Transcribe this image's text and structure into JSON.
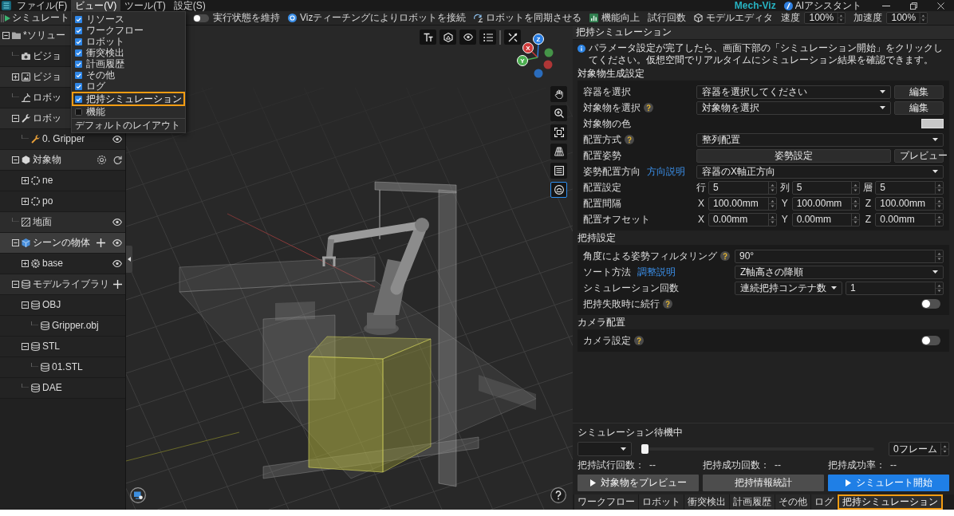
{
  "title_bar": {
    "menus": [
      {
        "label": "ファイル(F)",
        "selected": false
      },
      {
        "label": "ビュー(V)",
        "selected": true
      },
      {
        "label": "ツール(T)",
        "selected": false
      },
      {
        "label": "設定(S)",
        "selected": false
      }
    ],
    "app_name": "Mech-Viz",
    "assistant": "AIアシスタント"
  },
  "view_menu": [
    {
      "kind": "check",
      "label": "リソース",
      "checked": true,
      "highlighted": false
    },
    {
      "kind": "check",
      "label": "ワークフロー",
      "checked": true,
      "highlighted": false
    },
    {
      "kind": "check",
      "label": "ロボット",
      "checked": true,
      "highlighted": false
    },
    {
      "kind": "check",
      "label": "衝突検出",
      "checked": true,
      "highlighted": false
    },
    {
      "kind": "check",
      "label": "計画履歴",
      "checked": true,
      "highlighted": false
    },
    {
      "kind": "check",
      "label": "その他",
      "checked": true,
      "highlighted": false
    },
    {
      "kind": "check",
      "label": "ログ",
      "checked": true,
      "highlighted": false
    },
    {
      "kind": "check",
      "label": "把持シミュレーション",
      "checked": true,
      "highlighted": true
    },
    {
      "kind": "check",
      "label": "機能",
      "checked": false,
      "highlighted": false
    },
    {
      "kind": "action",
      "label": "デフォルトのレイアウト",
      "highlighted": false
    }
  ],
  "toolbar": {
    "keep_state": {
      "label": "実行状態を維持",
      "on": false
    },
    "actions": [
      {
        "label": "Vizティーチングによりロボットを接続"
      },
      {
        "label": "ロボットを同期させる"
      },
      {
        "label": "機能向上"
      },
      {
        "label": "試行回数"
      },
      {
        "label": "モデルエディタ"
      }
    ],
    "speed": {
      "label": "速度",
      "value": "100%"
    },
    "acceleration": {
      "label": "加速度",
      "value": "100%"
    }
  },
  "sidebar": {
    "simulate_button": "シミュレート",
    "tree": [
      {
        "kind": "solution",
        "label": "*ソリュー",
        "expanded": true,
        "selected": false,
        "children": [
          {
            "kind": "vision",
            "label": "ビジョ",
            "selected": false
          },
          {
            "kind": "visionset",
            "label": "ビジョ",
            "expanded": false,
            "selected": false
          },
          {
            "kind": "robot",
            "label": "ロボッ",
            "selected": false
          },
          {
            "kind": "tools",
            "label": "ロボッ",
            "expanded": true,
            "selected": false,
            "children": [
              {
                "kind": "tool",
                "label": "0. Gripper",
                "selected": false
              }
            ]
          },
          {
            "kind": "objects",
            "label": "対象物",
            "expanded": true,
            "selected": false,
            "children": [
              {
                "kind": "object",
                "label": "ne",
                "expanded": false,
                "selected": false
              },
              {
                "kind": "object",
                "label": "po",
                "expanded": false,
                "selected": false
              }
            ]
          },
          {
            "kind": "ground",
            "label": "地面",
            "selected": false
          },
          {
            "kind": "scene",
            "label": "シーンの物体",
            "expanded": true,
            "selected": true,
            "children": [
              {
                "kind": "sceneobject",
                "label": "base",
                "expanded": false,
                "selected": false
              }
            ]
          },
          {
            "kind": "library",
            "label": "モデルライブラリ",
            "expanded": true,
            "selected": false,
            "children": [
              {
                "kind": "folder",
                "label": "OBJ",
                "expanded": true,
                "selected": false,
                "children": [
                  {
                    "kind": "model",
                    "label": "Gripper.obj",
                    "selected": false
                  }
                ]
              },
              {
                "kind": "folder",
                "label": "STL",
                "expanded": true,
                "selected": false,
                "children": [
                  {
                    "kind": "model",
                    "label": "01.STL",
                    "selected": false
                  }
                ]
              },
              {
                "kind": "folder",
                "label": "DAE",
                "selected": false
              }
            ]
          }
        ]
      }
    ]
  },
  "viewport": {
    "axes": [
      {
        "label": "Z"
      },
      {
        "label": "X"
      },
      {
        "label": "Y"
      }
    ],
    "side_tools": [
      {
        "selected": false
      },
      {
        "selected": false
      },
      {
        "selected": false
      },
      {
        "selected": false
      },
      {
        "selected": false
      },
      {
        "selected": true
      }
    ]
  },
  "panel": {
    "title": "把持シミュレーション",
    "info": "パラメータ設定が完了したら、画面下部の「シミュレーション開始」をクリックしてください。仮想空間でリアルタイムにシミュレーション結果を確認できます。",
    "sections": [
      {
        "title": "対象物生成設定",
        "rows": [
          {
            "kind": "select_button",
            "label": "容器を選択",
            "value": "容器を選択してください",
            "button": "編集"
          },
          {
            "kind": "select_button",
            "label": "対象物を選択",
            "help": true,
            "value": "対象物を選択",
            "button": "編集"
          },
          {
            "kind": "color",
            "label": "対象物の色",
            "color": "#c8c8c8"
          },
          {
            "kind": "select",
            "label": "配置方式",
            "help": true,
            "value": "整列配置"
          },
          {
            "kind": "buttons",
            "label": "配置姿勢",
            "buttons": [
              "姿勢設定",
              "プレビュー"
            ]
          },
          {
            "kind": "select",
            "label": "姿勢配置方向",
            "link": "方向説明",
            "value": "容器のX軸正方向"
          },
          {
            "kind": "triple",
            "label": "配置設定",
            "fields": [
              {
                "axis": "行",
                "value": "5"
              },
              {
                "axis": "列",
                "value": "5"
              },
              {
                "axis": "層",
                "value": "5"
              }
            ]
          },
          {
            "kind": "triple",
            "label": "配置間隔",
            "fields": [
              {
                "axis": "X",
                "value": "100.00mm"
              },
              {
                "axis": "Y",
                "value": "100.00mm"
              },
              {
                "axis": "Z",
                "value": "100.00mm"
              }
            ]
          },
          {
            "kind": "triple",
            "label": "配置オフセット",
            "fields": [
              {
                "axis": "X",
                "value": "0.00mm"
              },
              {
                "axis": "Y",
                "value": "0.00mm"
              },
              {
                "axis": "Z",
                "value": "0.00mm"
              }
            ]
          }
        ]
      },
      {
        "title": "把持設定",
        "rows": [
          {
            "kind": "spin",
            "label": "角度による姿勢フィルタリング",
            "help": true,
            "value": "90°"
          },
          {
            "kind": "select",
            "label": "ソート方法",
            "link": "調整説明",
            "value": "Z軸高さの降順"
          },
          {
            "kind": "select_spin",
            "label": "シミュレーション回数",
            "value": "連続把持コンテナ数",
            "count": "1"
          },
          {
            "kind": "toggle",
            "label": "把持失敗時に続行",
            "help": true,
            "on": false
          }
        ]
      },
      {
        "title": "カメラ配置",
        "rows": [
          {
            "kind": "toggle",
            "label": "カメラ設定",
            "help": true,
            "on": false
          }
        ]
      }
    ]
  },
  "simulation": {
    "status": "シミュレーション待機中",
    "slider": {
      "level": 0
    },
    "frame": "0フレーム",
    "stats": [
      {
        "label": "把持試行回数：",
        "value": "--"
      },
      {
        "label": "把持成功回数：",
        "value": "--"
      },
      {
        "label": "把持成功率：",
        "value": "--"
      }
    ],
    "buttons": [
      {
        "kind": "play",
        "label": "対象物をプレビュー"
      },
      {
        "kind": "plain",
        "label": "把持情報統計"
      },
      {
        "kind": "primary",
        "label": "シミュレート開始"
      }
    ]
  },
  "bottom_tabs": [
    {
      "label": "ワークフロー",
      "selected": false
    },
    {
      "label": "ロボット",
      "selected": false
    },
    {
      "label": "衝突検出",
      "selected": false
    },
    {
      "label": "計画履歴",
      "selected": false
    },
    {
      "label": "その他",
      "selected": false
    },
    {
      "label": "ログ",
      "selected": false
    },
    {
      "label": "把持シミュレーション",
      "selected": true
    }
  ]
}
